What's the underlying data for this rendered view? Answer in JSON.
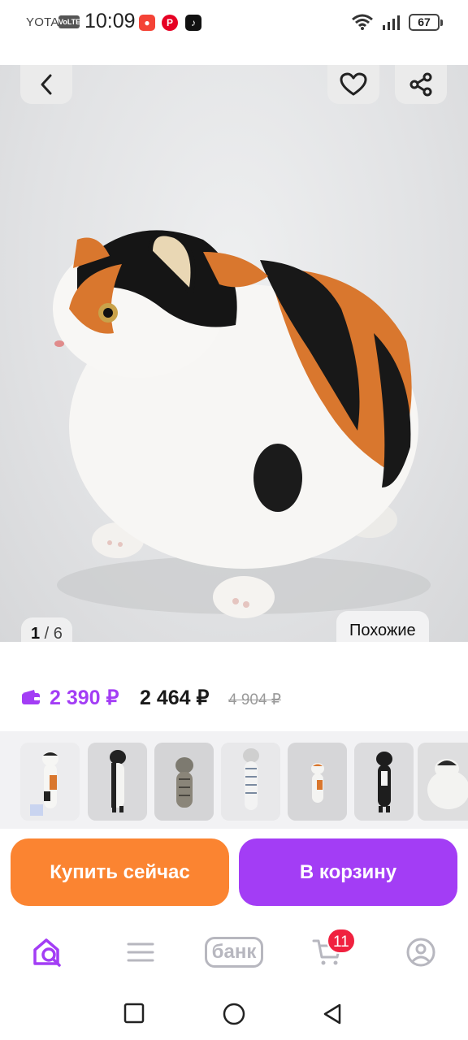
{
  "status_bar": {
    "carrier": "YOTA",
    "volte": "VoLTE",
    "time": "10:09",
    "battery": "67",
    "icons": [
      "screen-recorder-icon",
      "pinterest-icon",
      "tiktok-icon",
      "wifi-icon",
      "signal-icon",
      "battery-icon"
    ]
  },
  "gallery": {
    "counter_current": "1",
    "counter_total": "6",
    "similar_label": "Похожие",
    "icons": [
      "back-arrow-icon",
      "heart-icon",
      "share-icon"
    ]
  },
  "price": {
    "wallet_price": "2 390 ₽",
    "regular_price": "2 464 ₽",
    "old_price": "4 904 ₽",
    "wallet_color": "#a33df5"
  },
  "thumbnails": [
    {
      "name": "calico-plush-long"
    },
    {
      "name": "black-white-cat-plush"
    },
    {
      "name": "tabby-cat-plush"
    },
    {
      "name": "grey-tabby-cat-plush"
    },
    {
      "name": "small-calico-plush"
    },
    {
      "name": "black-cat-plush"
    },
    {
      "name": "round-cat-plush"
    }
  ],
  "actions": {
    "buy_now_label": "Купить сейчас",
    "add_to_cart_label": "В корзину",
    "buy_color": "#fb8431",
    "cart_color": "#a33df5"
  },
  "bottom_nav": {
    "bank_label": "банк",
    "cart_badge": "11",
    "active_color": "#a33df5"
  }
}
